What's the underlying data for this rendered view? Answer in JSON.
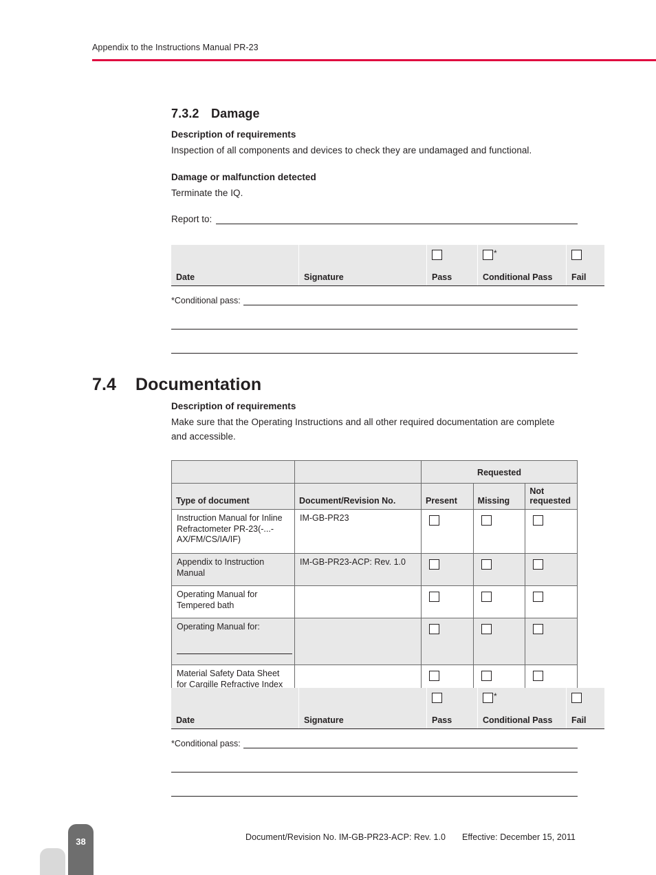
{
  "header": {
    "running_title": "Appendix to the Instructions Manual PR-23",
    "rule_color": "#e0063f"
  },
  "section_damage": {
    "number": "7.3.2",
    "title": "Damage",
    "desc_heading": "Description of requirements",
    "desc_text": "Inspection of all components and devices to check they are undamaged and functional.",
    "malfunction_heading": "Damage or malfunction detected",
    "malfunction_text": "Terminate the IQ.",
    "report_label": "Report to:"
  },
  "signature_table_1": {
    "columns": [
      "Date",
      "Signature",
      "Pass",
      "Conditional Pass",
      "Fail"
    ],
    "checkbox_columns": [
      "Pass",
      "Conditional Pass",
      "Fail"
    ],
    "conditional_marker": "*",
    "conditional_note": "*Conditional pass:"
  },
  "section_documentation": {
    "number": "7.4",
    "title": "Documentation",
    "desc_heading": "Description of requirements",
    "desc_text_line1": "Make sure that the Operating Instructions and all other required documentation are complete",
    "desc_text_line2": "and accessible."
  },
  "documentation_table": {
    "group_header": "Requested",
    "columns": [
      "Type of document",
      "Document/Revision No.",
      "Present",
      "Missing",
      "Not requested"
    ],
    "rows": [
      {
        "type": "Instruction Manual for Inline Refractometer PR-23(-...-AX/FM/CS/IA/IF)",
        "revision": "IM-GB-PR23",
        "present": "",
        "missing": "",
        "not_requested": ""
      },
      {
        "type": "Appendix to Instruction Manual",
        "revision": "IM-GB-PR23-ACP: Rev. 1.0",
        "present": "",
        "missing": "",
        "not_requested": ""
      },
      {
        "type": "Operating Manual for Tempered bath",
        "revision": "",
        "present": "",
        "missing": "",
        "not_requested": ""
      },
      {
        "type": "Operating Manual for:",
        "revision": "",
        "present": "",
        "missing": "",
        "not_requested": ""
      },
      {
        "type": "Material Safety Data Sheet for Cargille Refractive Index Liquids",
        "revision": "",
        "present": "",
        "missing": "",
        "not_requested": ""
      }
    ]
  },
  "signature_table_2": {
    "columns": [
      "Date",
      "Signature",
      "Pass",
      "Conditional Pass",
      "Fail"
    ],
    "conditional_marker": "*",
    "conditional_note": "*Conditional pass:"
  },
  "footer": {
    "page_number": "38",
    "document_revision": "Document/Revision No. IM-GB-PR23-ACP: Rev. 1.0",
    "effective": "Effective: December 15, 2011"
  }
}
